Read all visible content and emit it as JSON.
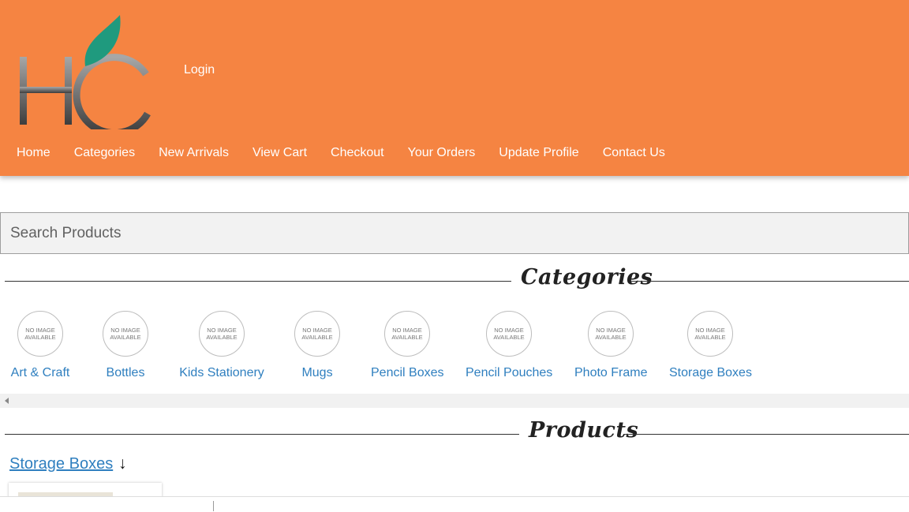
{
  "header": {
    "logo_text": "HC",
    "login_label": "Login",
    "nav": [
      "Home",
      "Categories",
      "New Arrivals",
      "View Cart",
      "Checkout",
      "Your Orders",
      "Update Profile",
      "Contact Us"
    ],
    "bg_color": "#f58442"
  },
  "search": {
    "placeholder": "Search Products"
  },
  "categories_section": {
    "title": "Categories",
    "placeholder_line1": "NO IMAGE",
    "placeholder_line2": "AVAILABLE",
    "items": [
      "Art & Craft",
      "Bottles",
      "Kids Stationery",
      "Mugs",
      "Pencil Boxes",
      "Pencil Pouches",
      "Photo Frame",
      "Storage Boxes"
    ]
  },
  "products_section": {
    "title": "Products",
    "current_category": "Storage Boxes",
    "arrow_icon": "↓"
  },
  "colors": {
    "accent": "#f58442",
    "link": "#2f7fbf"
  }
}
